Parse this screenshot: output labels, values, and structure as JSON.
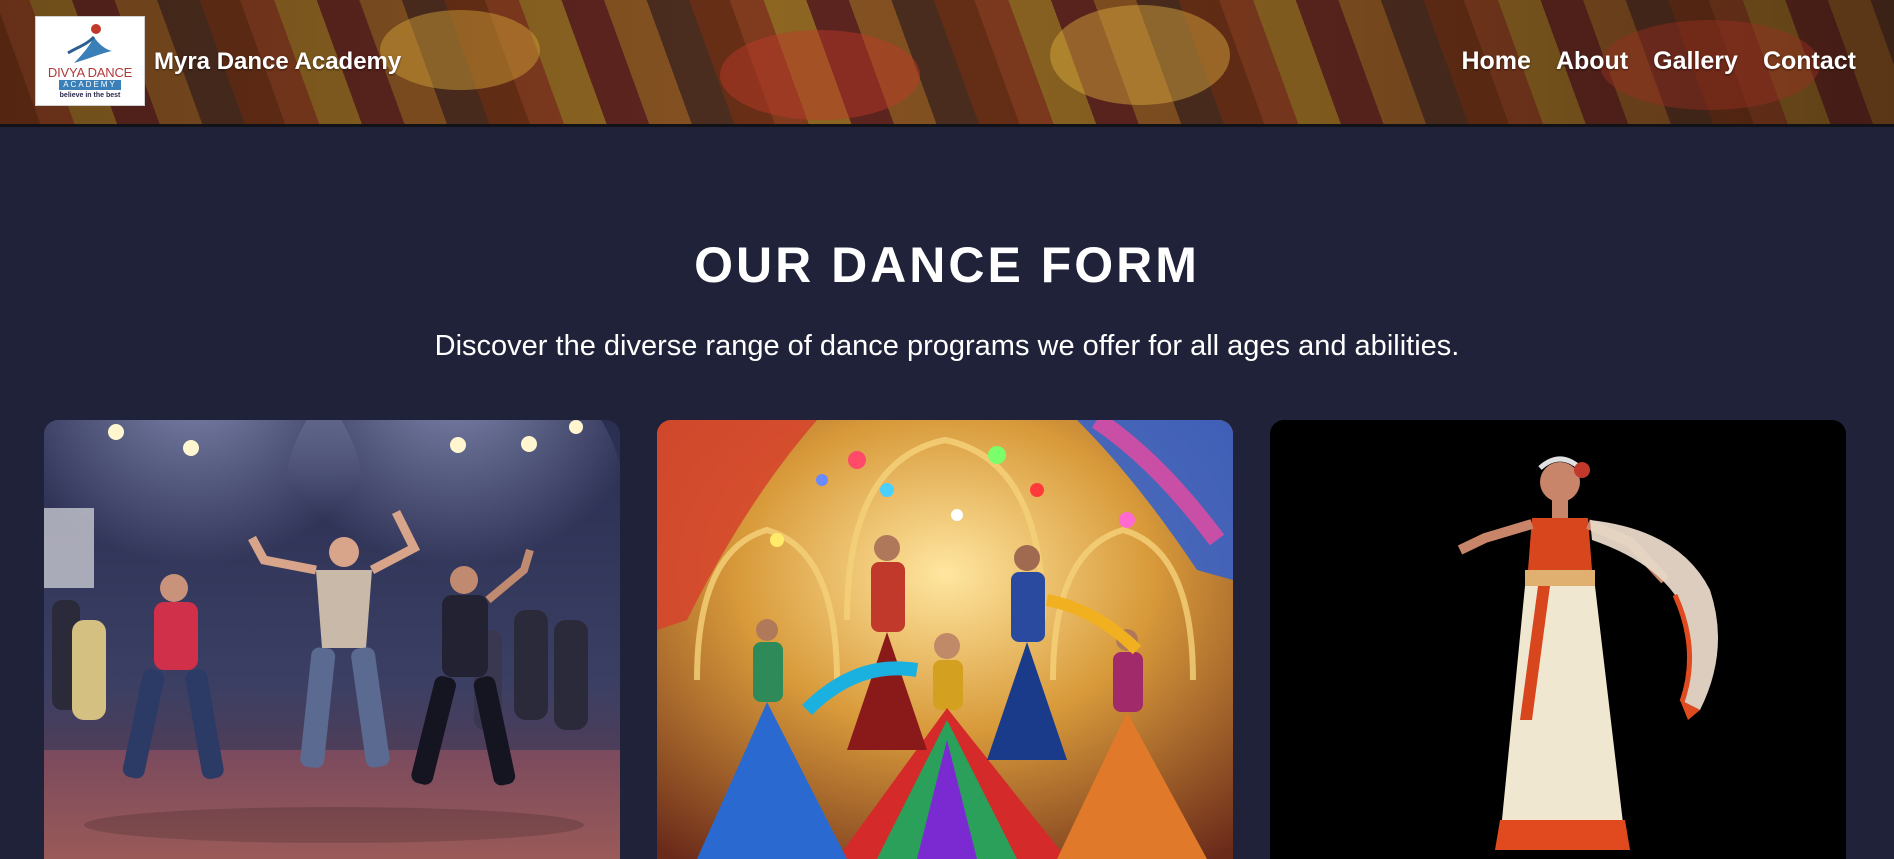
{
  "header": {
    "logo": {
      "line1": "DIVYA DANCE",
      "line2": "ACADEMY",
      "line3": "believe in the best"
    },
    "brand": "Myra Dance Academy",
    "nav": [
      "Home",
      "About",
      "Gallery",
      "Contact"
    ]
  },
  "section": {
    "title": "OUR DANCE FORM",
    "subtitle": "Discover the diverse range of dance programs we offer for all ages and abilities."
  },
  "cards": [
    {
      "image": "hip-hop-dance-group-image"
    },
    {
      "image": "bollywood-dance-group-image"
    },
    {
      "image": "classical-dancer-image"
    }
  ],
  "colors": {
    "background": "#1f2239",
    "text": "#ffffff"
  }
}
